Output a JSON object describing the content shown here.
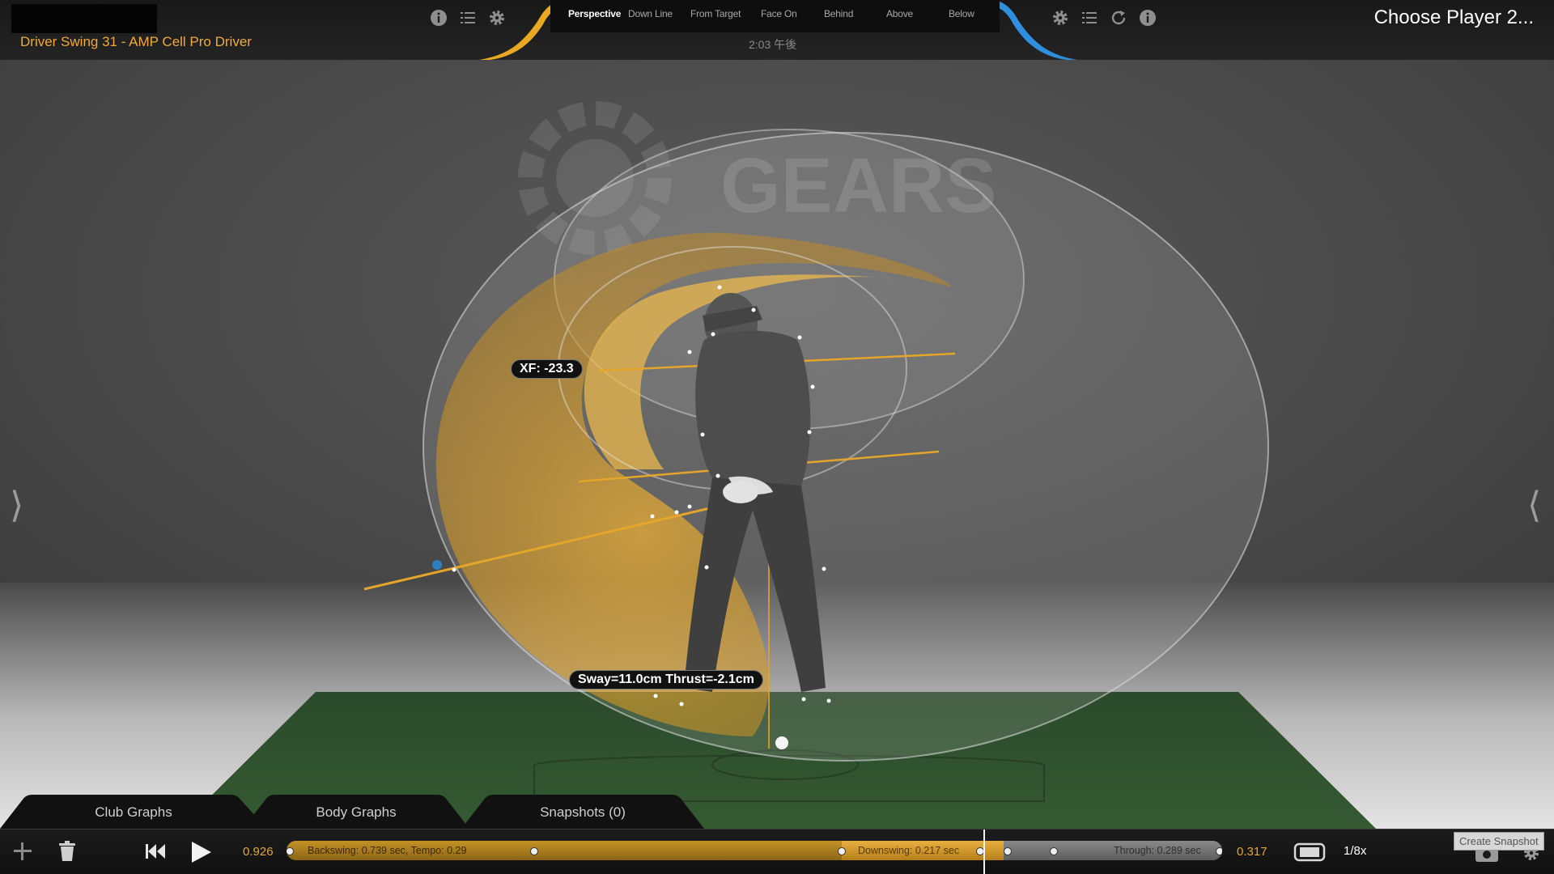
{
  "header": {
    "session_title": "Driver Swing 31 - AMP Cell Pro Driver",
    "clock": "2:03 午後",
    "player_label": "Choose Player 2...",
    "left_icons": [
      "info-icon",
      "list-icon",
      "gear-icon"
    ],
    "right_icons": [
      "gear-icon",
      "list-icon",
      "refresh-icon",
      "info-icon"
    ],
    "accent_left": "#e9a922",
    "accent_right": "#2f8fde"
  },
  "views": {
    "active": "Perspective",
    "items": [
      "Perspective",
      "Down Line",
      "From Target",
      "Face On",
      "Behind",
      "Above",
      "Below"
    ]
  },
  "scene": {
    "watermark": "GEARS",
    "xf_label": "XF: -23.3",
    "sway_label": "Sway=11.0cm Thrust=-2.1cm",
    "left_arrow": "⟩",
    "right_arrow": "⟨"
  },
  "bottom_tabs": [
    "Club Graphs",
    "Body Graphs",
    "Snapshots (0)"
  ],
  "controls": {
    "start_time": "0.926",
    "end_time": "0.317",
    "backswing": "Backswing: 0.739 sec, Tempo: 0.29",
    "downswing": "Downswing: 0.217 sec",
    "through": "Through: 0.289 sec",
    "speed": "1/8x",
    "snapshot_tooltip": "Create Snapshot"
  }
}
